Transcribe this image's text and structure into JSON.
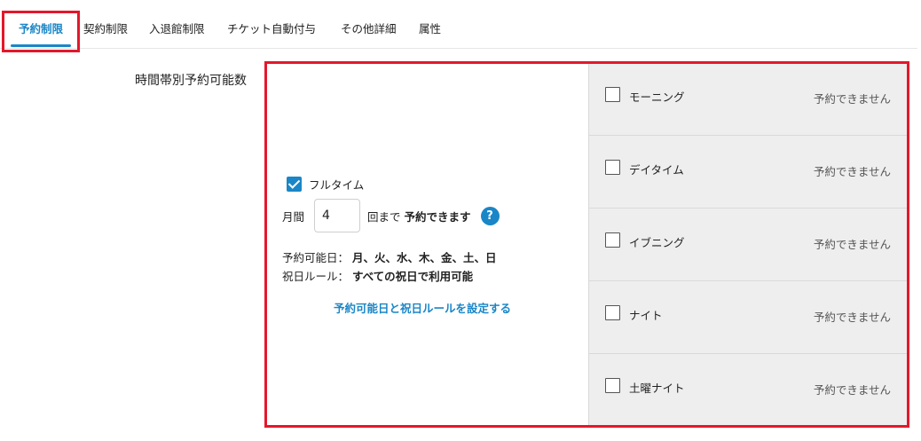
{
  "tabs": [
    {
      "label": "予約制限",
      "active": true
    },
    {
      "label": "契約制限",
      "active": false
    },
    {
      "label": "入退館制限",
      "active": false
    },
    {
      "label": "チケット自動付与",
      "active": false
    },
    {
      "label": "その他詳細",
      "active": false
    },
    {
      "label": "属性",
      "active": false
    }
  ],
  "section_label": "時間帯別予約可能数",
  "fulltime": {
    "checked": true,
    "label": "フルタイム",
    "period_label": "月間",
    "count_value": "4",
    "count_suffix": "回まで",
    "availability": "予約できます",
    "help_glyph": "?"
  },
  "days": {
    "label": "予約可能日：",
    "value": "月、火、水、木、金、土、日"
  },
  "holiday": {
    "label": "祝日ルール：",
    "value": "すべての祝日で利用可能"
  },
  "settings_link": "予約可能日と祝日ルールを設定する",
  "slots": [
    {
      "name": "モーニング",
      "checked": false,
      "status": "予約できません"
    },
    {
      "name": "デイタイム",
      "checked": false,
      "status": "予約できません"
    },
    {
      "name": "イブニング",
      "checked": false,
      "status": "予約できません"
    },
    {
      "name": "ナイト",
      "checked": false,
      "status": "予約できません"
    },
    {
      "name": "土曜ナイト",
      "checked": false,
      "status": "予約できません"
    }
  ],
  "colors": {
    "accent": "#1a86c7",
    "highlight": "#e4172a",
    "slot_bg": "#eeeeee"
  }
}
